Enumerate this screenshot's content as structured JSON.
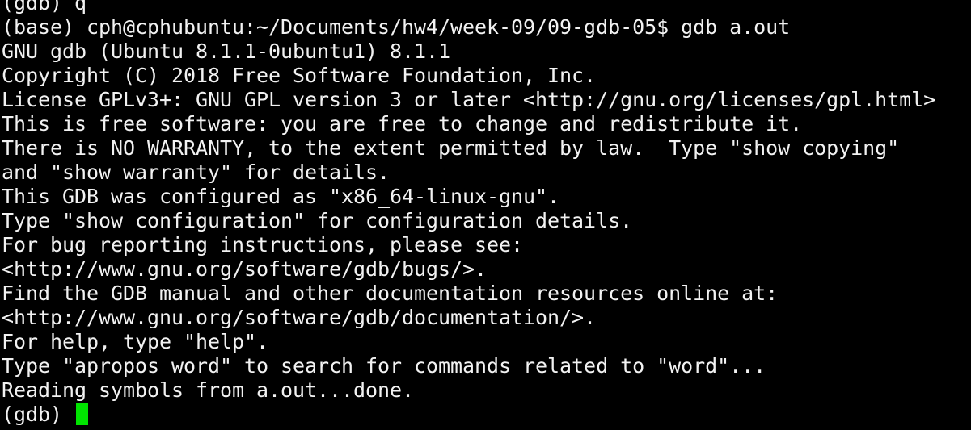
{
  "colors": {
    "background": "#000000",
    "foreground": "#f2f2f2",
    "cursor": "#00e400"
  },
  "terminal": {
    "clipped_top_line": "(gdb) q",
    "shell_prompt": "(base) cph@cphubuntu:~/Documents/hw4/week-09/09-gdb-05$ ",
    "command": "gdb a.out",
    "output_lines": [
      "GNU gdb (Ubuntu 8.1.1-0ubuntu1) 8.1.1",
      "Copyright (C) 2018 Free Software Foundation, Inc.",
      "License GPLv3+: GNU GPL version 3 or later <http://gnu.org/licenses/gpl.html>",
      "This is free software: you are free to change and redistribute it.",
      "There is NO WARRANTY, to the extent permitted by law.  Type \"show copying\"",
      "and \"show warranty\" for details.",
      "This GDB was configured as \"x86_64-linux-gnu\".",
      "Type \"show configuration\" for configuration details.",
      "For bug reporting instructions, please see:",
      "<http://www.gnu.org/software/gdb/bugs/>.",
      "Find the GDB manual and other documentation resources online at:",
      "<http://www.gnu.org/software/gdb/documentation/>.",
      "For help, type \"help\".",
      "Type \"apropos word\" to search for commands related to \"word\"...",
      "Reading symbols from a.out...done."
    ],
    "gdb_prompt": "(gdb) "
  }
}
